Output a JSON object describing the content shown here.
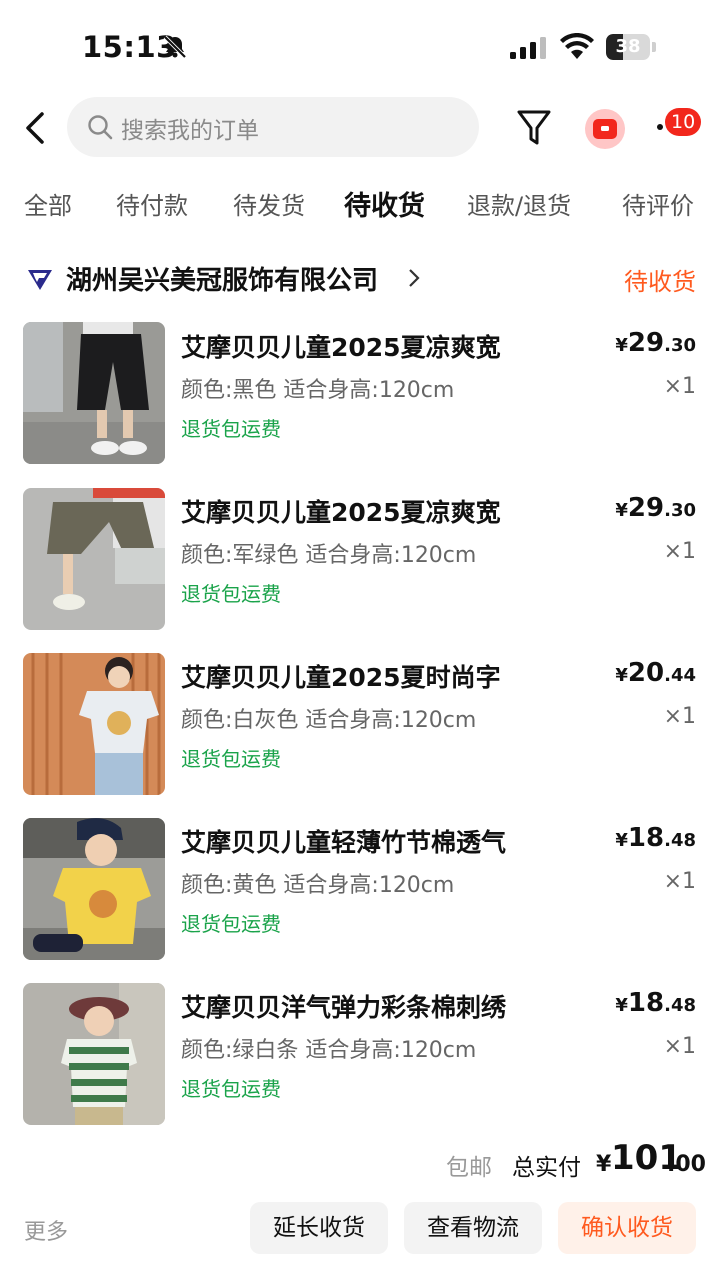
{
  "status_bar": {
    "time": "15:13",
    "battery": "38",
    "battery_level": 0.38
  },
  "search": {
    "placeholder": "搜索我的订单"
  },
  "header": {
    "badge_count": "10"
  },
  "tabs": [
    "全部",
    "待付款",
    "待发货",
    "待收货",
    "退款/退货",
    "待评价"
  ],
  "active_tab": "待收货",
  "shop": {
    "name": "湖州吴兴美冠服饰有限公司",
    "status": "待收货"
  },
  "items": [
    {
      "title": "艾摩贝贝儿童2025夏凉爽宽",
      "spec": "颜色:黑色 适合身高:120cm",
      "tag": "退货包运费",
      "currency": "¥",
      "price_int": "29",
      "price_dec": ".30",
      "qty": "×1"
    },
    {
      "title": "艾摩贝贝儿童2025夏凉爽宽",
      "spec": "颜色:军绿色 适合身高:120cm",
      "tag": "退货包运费",
      "currency": "¥",
      "price_int": "29",
      "price_dec": ".30",
      "qty": "×1"
    },
    {
      "title": "艾摩贝贝儿童2025夏时尚字",
      "spec": "颜色:白灰色 适合身高:120cm",
      "tag": "退货包运费",
      "currency": "¥",
      "price_int": "20",
      "price_dec": ".44",
      "qty": "×1"
    },
    {
      "title": "艾摩贝贝儿童轻薄竹节棉透气",
      "spec": "颜色:黄色 适合身高:120cm",
      "tag": "退货包运费",
      "currency": "¥",
      "price_int": "18",
      "price_dec": ".48",
      "qty": "×1"
    },
    {
      "title": "艾摩贝贝洋气弹力彩条棉刺绣",
      "spec": "颜色:绿白条 适合身高:120cm",
      "tag": "退货包运费",
      "currency": "¥",
      "price_int": "18",
      "price_dec": ".48",
      "qty": "×1"
    }
  ],
  "summary": {
    "shipping": "包邮",
    "total_label": "总实付",
    "currency": "¥",
    "total_int": "101",
    "total_dec": ".00"
  },
  "actions": {
    "more": "更多",
    "extend": "延长收货",
    "logistics": "查看物流",
    "confirm": "确认收货"
  },
  "colors": {
    "accent": "#ff5a1f",
    "green_tag": "#1aa34a",
    "badge": "#f2271c"
  }
}
